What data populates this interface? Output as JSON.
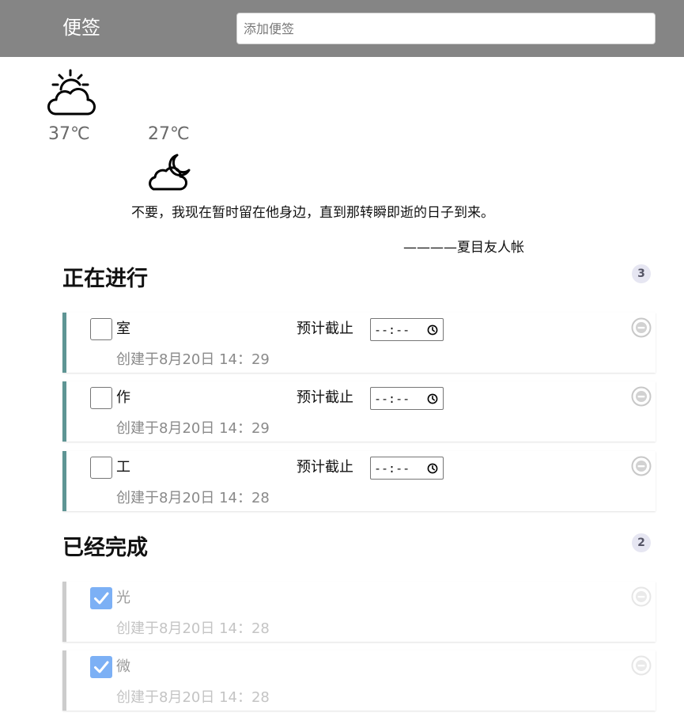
{
  "header": {
    "title": "便签",
    "add_placeholder": "添加便签"
  },
  "weather": {
    "day_icon": "sun-behind-cloud-icon",
    "night_icon": "moon-behind-cloud-icon",
    "high_temp": "37℃",
    "low_temp": "27℃"
  },
  "quote": {
    "text": "不要，我现在暂时留在他身边，直到那转瞬即逝的日子到来。",
    "author": "————夏目友人帐"
  },
  "in_progress": {
    "title": "正在进行",
    "count": "3",
    "items": [
      {
        "text": "室",
        "deadline_label": "预计截止",
        "deadline_value": "--:--",
        "created": "创建于8月20日 14：29",
        "checked": false
      },
      {
        "text": "作",
        "deadline_label": "预计截止",
        "deadline_value": "--:--",
        "created": "创建于8月20日 14：29",
        "checked": false
      },
      {
        "text": "工",
        "deadline_label": "预计截止",
        "deadline_value": "--:--",
        "created": "创建于8月20日 14：28",
        "checked": false
      }
    ]
  },
  "completed": {
    "title": "已经完成",
    "count": "2",
    "items": [
      {
        "text": "光",
        "created": "创建于8月20日 14：28",
        "checked": true
      },
      {
        "text": "微",
        "created": "创建于8月20日 14：28",
        "checked": true
      }
    ]
  },
  "colors": {
    "header_bg": "#858585",
    "active_accent": "#5e9594",
    "done_accent": "#cccccc",
    "checkbox_checked": "#7cb0f5"
  }
}
